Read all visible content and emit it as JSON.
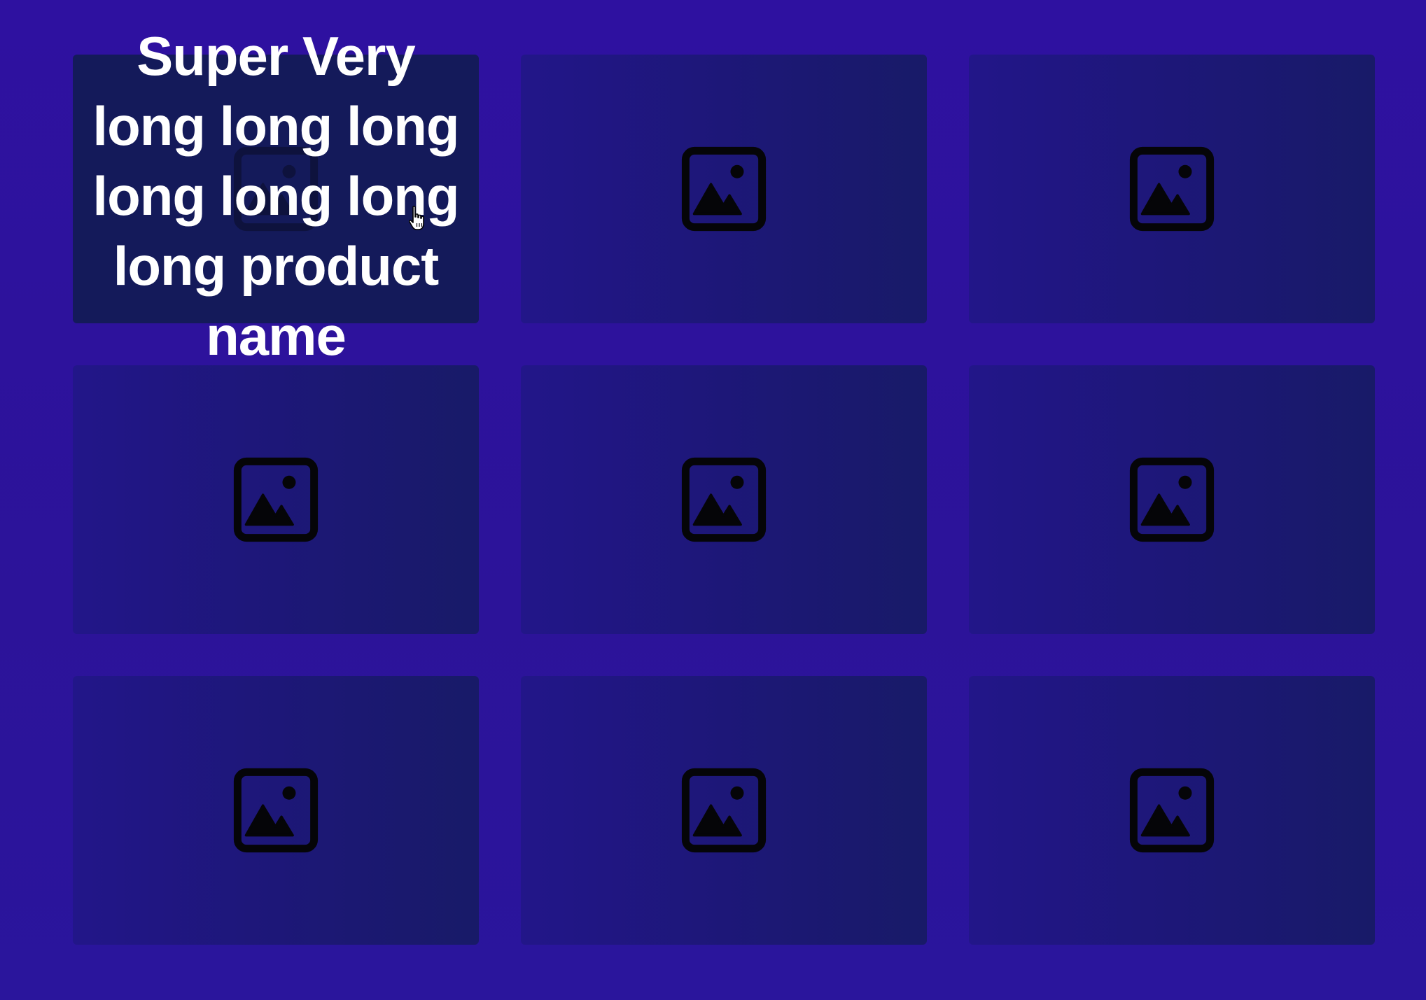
{
  "product_grid": {
    "products": [
      {
        "name": "Super Very long long long long long long long product name",
        "image_icon": "image-placeholder-icon",
        "hovered": true
      },
      {
        "name": "",
        "image_icon": "image-placeholder-icon",
        "hovered": false
      },
      {
        "name": "",
        "image_icon": "image-placeholder-icon",
        "hovered": false
      },
      {
        "name": "",
        "image_icon": "image-placeholder-icon",
        "hovered": false
      },
      {
        "name": "",
        "image_icon": "image-placeholder-icon",
        "hovered": false
      },
      {
        "name": "",
        "image_icon": "image-placeholder-icon",
        "hovered": false
      },
      {
        "name": "",
        "image_icon": "image-placeholder-icon",
        "hovered": false
      },
      {
        "name": "",
        "image_icon": "image-placeholder-icon",
        "hovered": false
      },
      {
        "name": "",
        "image_icon": "image-placeholder-icon",
        "hovered": false
      }
    ]
  },
  "colors": {
    "background": "#2e11a0",
    "card": "#1d1778",
    "card_hover": "#141a5a",
    "title_text": "#ffffff",
    "icon": "#050508"
  },
  "cursor": {
    "icon": "hand-pointer-icon"
  }
}
